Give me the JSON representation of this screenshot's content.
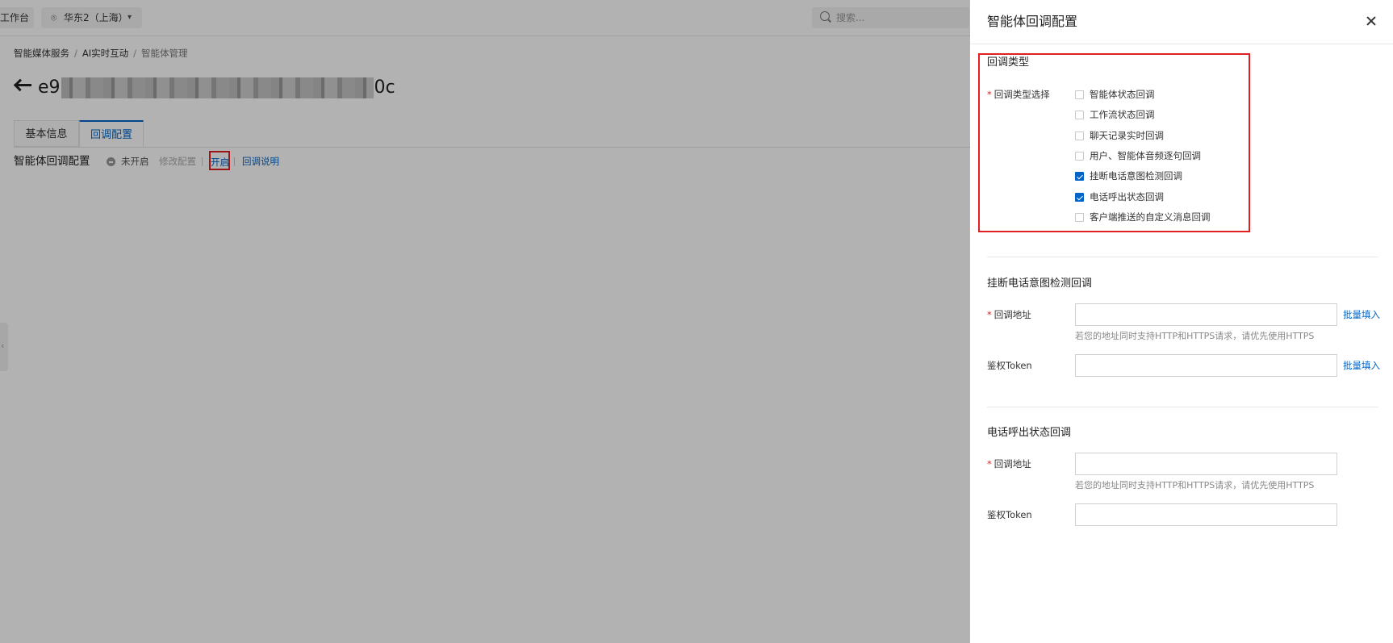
{
  "topbar": {
    "workbench": "工作台",
    "region": "华东2（上海）",
    "search_placeholder": "搜索..."
  },
  "breadcrumb": [
    "智能媒体服务",
    "AI实时互动",
    "智能体管理"
  ],
  "title": {
    "id_prefix": "e9",
    "id_suffix": "0c"
  },
  "tabs": [
    "基本信息",
    "回调配置"
  ],
  "callback": {
    "title": "智能体回调配置",
    "status": "未开启",
    "modify": "修改配置",
    "enable": "开启",
    "explain": "回调说明"
  },
  "drawer": {
    "title": "智能体回调配置",
    "type_section": "回调类型",
    "type_label": "回调类型选择",
    "options": [
      {
        "label": "智能体状态回调",
        "checked": false
      },
      {
        "label": "工作流状态回调",
        "checked": false
      },
      {
        "label": "聊天记录实时回调",
        "checked": false
      },
      {
        "label": "用户、智能体音频逐句回调",
        "checked": false
      },
      {
        "label": "挂断电话意图检测回调",
        "checked": true
      },
      {
        "label": "电话呼出状态回调",
        "checked": true
      },
      {
        "label": "客户端推送的自定义消息回调",
        "checked": false
      }
    ],
    "section1": {
      "title": "挂断电话意图检测回调",
      "url_label": "回调地址",
      "url_value": "",
      "hint": "若您的地址同时支持HTTP和HTTPS请求，请优先使用HTTPS",
      "token_label": "鉴权Token",
      "token_value": "",
      "batch": "批量填入"
    },
    "section2": {
      "title": "电话呼出状态回调",
      "url_label": "回调地址",
      "url_value": "",
      "hint": "若您的地址同时支持HTTP和HTTPS请求，请优先使用HTTPS",
      "token_label": "鉴权Token",
      "token_value": ""
    }
  },
  "colors": {
    "accent": "#0064c8",
    "highlight": "#e02020",
    "required": "#e02020"
  }
}
